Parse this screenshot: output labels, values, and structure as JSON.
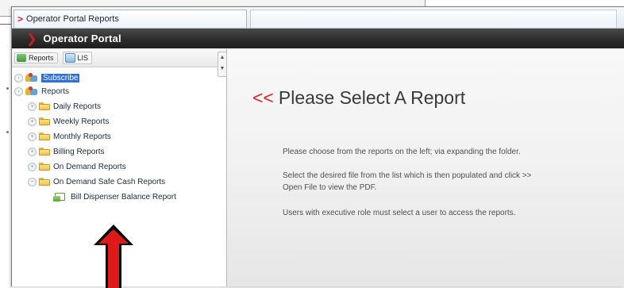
{
  "tab": {
    "title": "Operator Portal Reports",
    "chevron": ">"
  },
  "header": {
    "logo_glyph": "❯",
    "title": "Operator Portal"
  },
  "toolbar": {
    "reports_label": "Reports",
    "lis_label": "LIS"
  },
  "tree": {
    "subscribe": "Subscribe",
    "reports": "Reports",
    "folders": [
      "Daily Reports",
      "Weekly Reports",
      "Monthly Reports",
      "Billing Reports",
      "On Demand Reports",
      "On Demand Safe Cash Reports"
    ],
    "leaf": "Bill Dispenser Balance Report"
  },
  "main": {
    "arrows": "<<",
    "title": "Please Select A Report",
    "p1": "Please choose from the reports on the left; via expanding the folder.",
    "p2": "Select the desired file from the list which is then populated and click >> Open File to view the PDF.",
    "p3": "Users with executive role must select a user to access the reports."
  },
  "colors": {
    "accent_red": "#e02020",
    "header_dark": "#2b2b2b",
    "selection_blue": "#2f6fd8"
  }
}
